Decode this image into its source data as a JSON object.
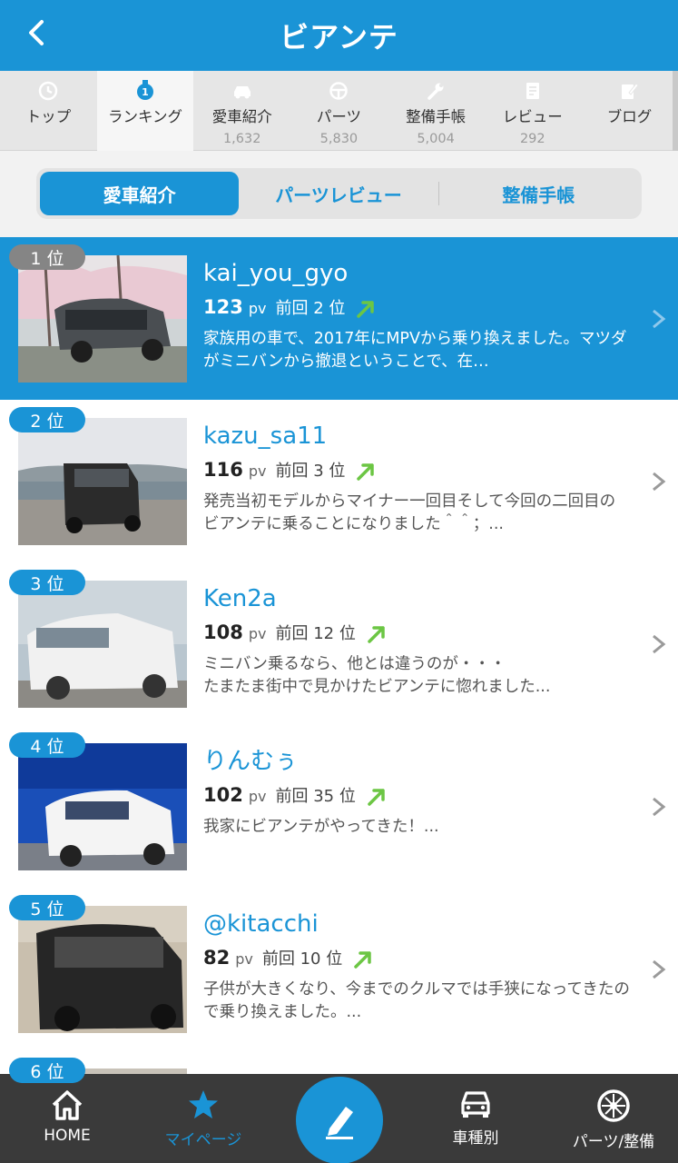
{
  "header": {
    "title": "ビアンテ"
  },
  "category_tabs": [
    {
      "label": "トップ",
      "count": ""
    },
    {
      "label": "ランキング",
      "count": ""
    },
    {
      "label": "愛車紹介",
      "count": "1,632"
    },
    {
      "label": "パーツ",
      "count": "5,830"
    },
    {
      "label": "整備手帳",
      "count": "5,004"
    },
    {
      "label": "レビュー",
      "count": "292"
    },
    {
      "label": "ブログ",
      "count": ""
    }
  ],
  "segments": [
    {
      "label": "愛車紹介"
    },
    {
      "label": "パーツレビュー"
    },
    {
      "label": "整備手帳"
    }
  ],
  "rankings": [
    {
      "rank": "1 位",
      "name": "kai_you_gyo",
      "pv": "123",
      "pv_unit": "pv",
      "prev": "前回 2 位",
      "desc": "家族用の車で、2017年にMPVから乗り換えました。マツダがミニバンから撤退ということで、在…"
    },
    {
      "rank": "2 位",
      "name": "kazu_sa11",
      "pv": "116",
      "pv_unit": "pv",
      "prev": "前回 3 位",
      "desc": "発売当初モデルからマイナー一回目そして今回の二回目のビアンテに乗ることになりました＾＾；..."
    },
    {
      "rank": "3 位",
      "name": "Ken2a",
      "pv": "108",
      "pv_unit": "pv",
      "prev": "前回 12 位",
      "desc": "ミニバン乗るなら、他とは違うのが・・・\nたまたま街中で見かけたビアンテに惚れました..."
    },
    {
      "rank": "4 位",
      "name": "りんむぅ",
      "pv": "102",
      "pv_unit": "pv",
      "prev": "前回 35 位",
      "desc": "我家にビアンテがやってきた！..."
    },
    {
      "rank": "5 位",
      "name": "@kitacchi",
      "pv": "82",
      "pv_unit": "pv",
      "prev": "前回 10 位",
      "desc": "子供が大きくなり、今までのクルマでは手狭になってきたので乗り換えました。..."
    },
    {
      "rank": "6 位",
      "name": "",
      "pv": "",
      "pv_unit": "",
      "prev": "",
      "desc": ""
    }
  ],
  "tabbar": {
    "home": "HOME",
    "mypage": "マイページ",
    "cartype": "車種別",
    "parts": "パーツ/整備"
  },
  "colors": {
    "accent": "#1a94d6",
    "tabbar_bg": "#3a3a3a",
    "trend_up": "#6cc644"
  }
}
